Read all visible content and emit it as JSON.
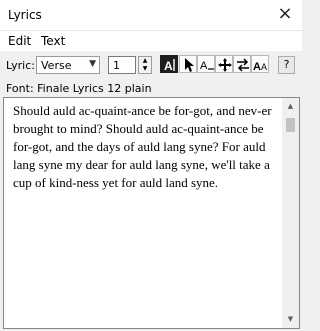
{
  "window": {
    "title": "Lyrics",
    "close_glyph": "×"
  },
  "menu": {
    "items": [
      "Edit",
      "Text"
    ]
  },
  "toolbar": {
    "lyric_label": "Lyric:",
    "lyric_type": "Verse",
    "number": "1",
    "help_label": "?"
  },
  "font_info": "Font: Finale Lyrics 12 plain",
  "lyrics_text": "Should auld ac-quaint-ance be for-got, and nev-er brought to mind? Should auld ac-quaint-ance be for-got, and the days of auld lang syne? For auld lang syne my dear for auld lang syne, we'll take a cup of kind-ness yet for auld land syne.",
  "icons": {
    "type_into_score": "type-into-score-icon",
    "click_assignment": "arrow-pointer-icon",
    "adjust_syllables": "adjust-syllables-icon",
    "shift_lyrics": "move-cross-icon",
    "edit_word_extensions": "swap-arrows-icon",
    "edit_lyric_font": "font-aa-icon"
  }
}
